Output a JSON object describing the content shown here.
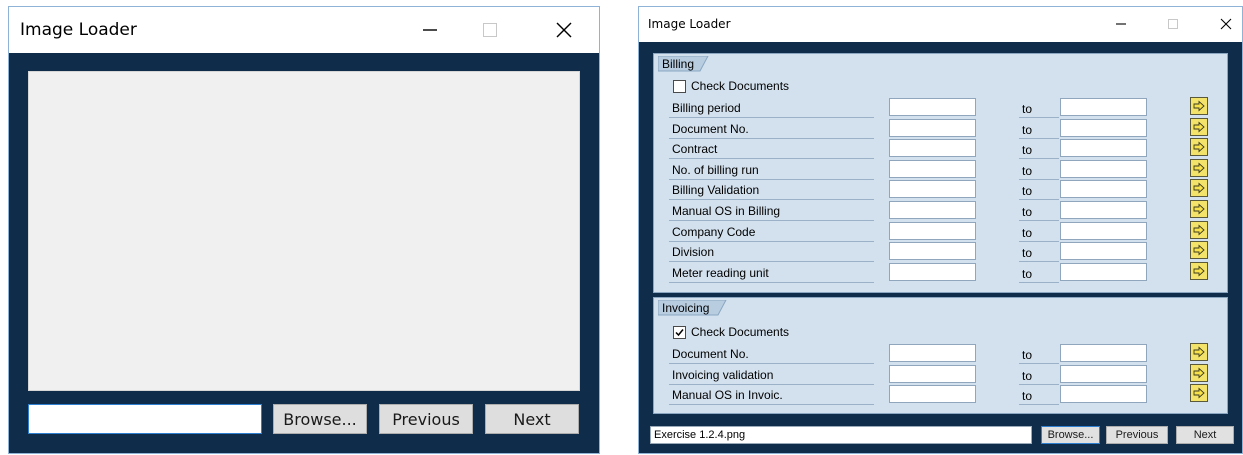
{
  "window1": {
    "title": "Image Loader",
    "path_value": "",
    "buttons": {
      "browse": "Browse...",
      "previous": "Previous",
      "next": "Next"
    }
  },
  "window2": {
    "title": "Image Loader",
    "billing": {
      "title": "Billing",
      "check_label": "Check Documents",
      "checked": false,
      "rows": [
        {
          "label": "Billing period",
          "to": "to"
        },
        {
          "label": "Document No.",
          "to": "to"
        },
        {
          "label": "Contract",
          "to": "to"
        },
        {
          "label": "No. of billing run",
          "to": "to"
        },
        {
          "label": "Billing Validation",
          "to": "to"
        },
        {
          "label": "Manual OS in Billing",
          "to": "to"
        },
        {
          "label": "Company Code",
          "to": "to"
        },
        {
          "label": "Division",
          "to": "to"
        },
        {
          "label": "Meter reading unit",
          "to": "to"
        }
      ]
    },
    "invoicing": {
      "title": "Invoicing",
      "check_label": "Check Documents",
      "checked": true,
      "rows": [
        {
          "label": "Document No.",
          "to": "to"
        },
        {
          "label": "Invoicing validation",
          "to": "to"
        },
        {
          "label": "Manual OS in Invoic.",
          "to": "to"
        }
      ]
    },
    "path_value": "Exercise 1.2.4.png",
    "buttons": {
      "browse": "Browse...",
      "previous": "Previous",
      "next": "Next"
    }
  },
  "icons": {
    "minimize": "minimize-icon",
    "maximize": "maximize-icon",
    "close": "close-icon",
    "multiple_selection": "arrow-right-icon"
  },
  "colors": {
    "client_background": "#0f2c4b",
    "group_background": "#d3e1ee",
    "arrow_button": "#f4e36a"
  }
}
